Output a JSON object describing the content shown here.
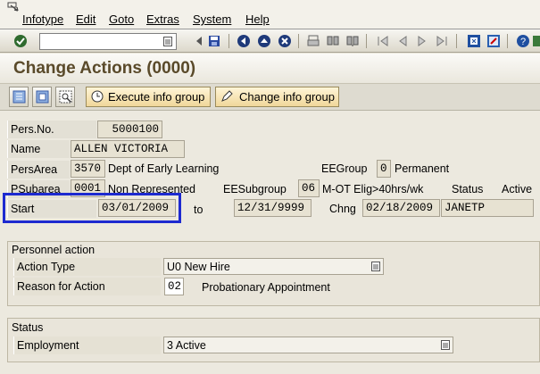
{
  "menu": [
    "Infotype",
    "Edit",
    "Goto",
    "Extras",
    "System",
    "Help"
  ],
  "toolbar": {
    "command_value": "",
    "icons": [
      "enter-icon",
      "dropdown-icon",
      "back-arrow-icon",
      "save-icon",
      "back-icon",
      "exit-icon",
      "cancel-icon",
      "print-icon",
      "find-icon",
      "find-next-icon",
      "first-page-icon",
      "prev-page-icon",
      "next-page-icon",
      "last-page-icon",
      "new-session-icon",
      "shortcut-icon",
      "help-icon",
      "layout-menu-icon"
    ]
  },
  "title": "Change Actions (0000)",
  "app_toolbar": {
    "execute_label": "Execute info group",
    "change_label": "Change info group"
  },
  "header": {
    "pers_no_label": "Pers.No.",
    "pers_no": "5000100",
    "name_label": "Name",
    "name": "ALLEN VICTORIA",
    "pers_area_label": "PersArea",
    "pers_area_code": "3570",
    "pers_area_text": "Dept of Early Learning",
    "ee_group_label": "EEGroup",
    "ee_group_code": "0",
    "ee_group_text": "Permanent",
    "psubarea_label": "PSubarea",
    "psubarea_code": "0001",
    "psubarea_text": "Non Represented",
    "ee_subgroup_label": "EESubgroup",
    "ee_subgroup_code": "06",
    "ee_subgroup_text": "M-OT Elig>40hrs/wk",
    "status_label": "Status",
    "status_value": "Active",
    "start_label": "Start",
    "start": "03/01/2009",
    "to_label": "to",
    "end": "12/31/9999",
    "chng_label": "Chng",
    "chng_date": "02/18/2009",
    "chng_user": "JANETP"
  },
  "personnel_action": {
    "title": "Personnel action",
    "action_type_label": "Action Type",
    "action_type_value": "U0 New Hire",
    "reason_label": "Reason for Action",
    "reason_code": "02",
    "reason_text": "Probationary Appointment"
  },
  "status_group": {
    "title": "Status",
    "employment_label": "Employment",
    "employment_value": "3 Active"
  },
  "colors": {
    "title": "#5a4a2a",
    "highlight": "#1d2ad0",
    "button": "#f0d79a"
  }
}
